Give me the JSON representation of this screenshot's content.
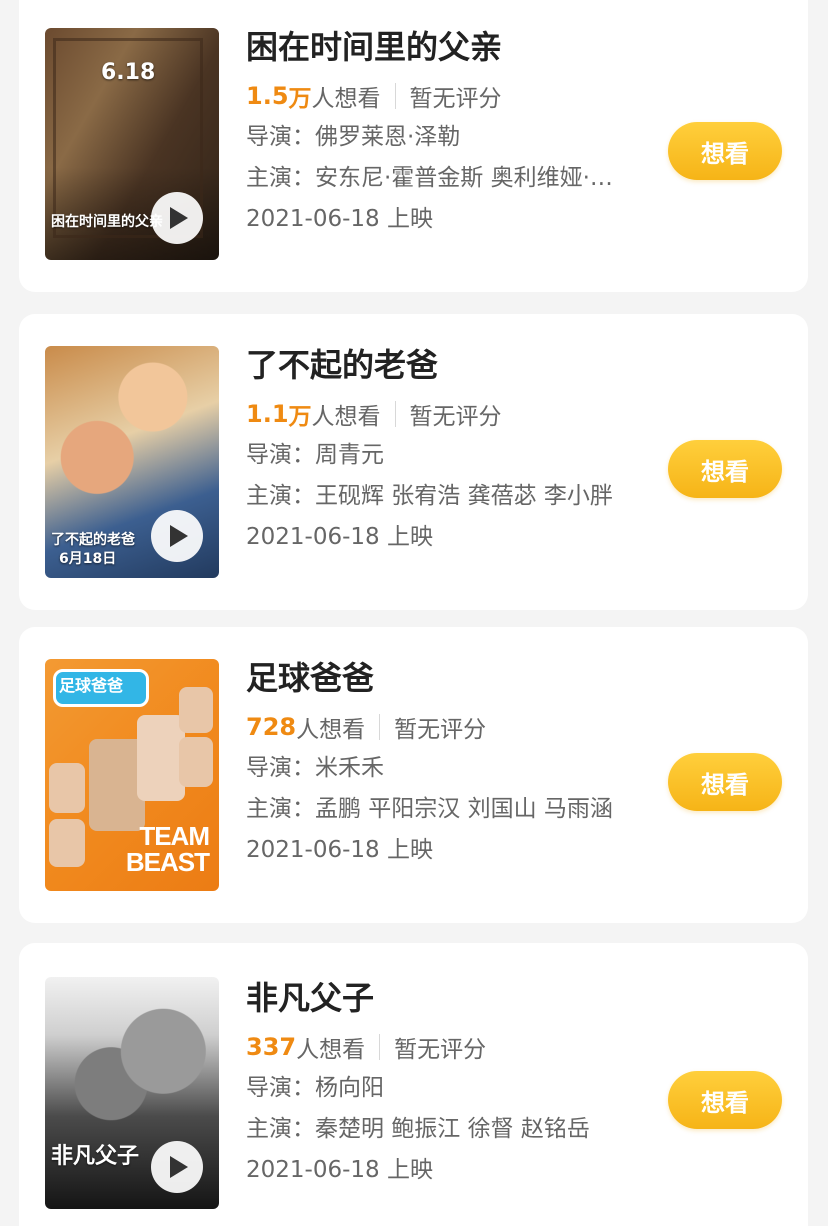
{
  "movies": [
    {
      "title": "困在时间里的父亲",
      "want_count": "1.5",
      "want_unit": "万",
      "want_suffix": "人想看",
      "rating": "暂无评分",
      "director": "导演：佛罗莱恩·泽勒",
      "cast": "主演：安东尼·霍普金斯 奥利维娅·…",
      "release": "2021-06-18 上映",
      "button": "想看",
      "poster_date": "6.18",
      "poster_title": "困在时间里的父亲"
    },
    {
      "title": "了不起的老爸",
      "want_count": "1.1",
      "want_unit": "万",
      "want_suffix": "人想看",
      "rating": "暂无评分",
      "director": "导演：周青元",
      "cast": "主演：王砚辉 张宥浩 龚蓓苾 李小胖",
      "release": "2021-06-18 上映",
      "button": "想看",
      "poster_date": "6月18日",
      "poster_title": "了不起的老爸"
    },
    {
      "title": "足球爸爸",
      "want_count": "728",
      "want_unit": "",
      "want_suffix": "人想看",
      "rating": "暂无评分",
      "director": "导演：米禾禾",
      "cast": "主演：孟鹏 平阳宗汉 刘国山 马雨涵",
      "release": "2021-06-18 上映",
      "button": "想看",
      "poster_brand": "足球爸爸",
      "poster_text": "TEAM BEAST"
    },
    {
      "title": "非凡父子",
      "want_count": "337",
      "want_unit": "",
      "want_suffix": "人想看",
      "rating": "暂无评分",
      "director": "导演：杨向阳",
      "cast": "主演：秦楚明 鲍振江 徐督 赵铭岳",
      "release": "2021-06-18 上映",
      "button": "想看",
      "poster_title": "非凡父子"
    }
  ],
  "colors": {
    "accent": "#ef8a12",
    "button": "#f6b417",
    "background": "#f4f4f4"
  }
}
